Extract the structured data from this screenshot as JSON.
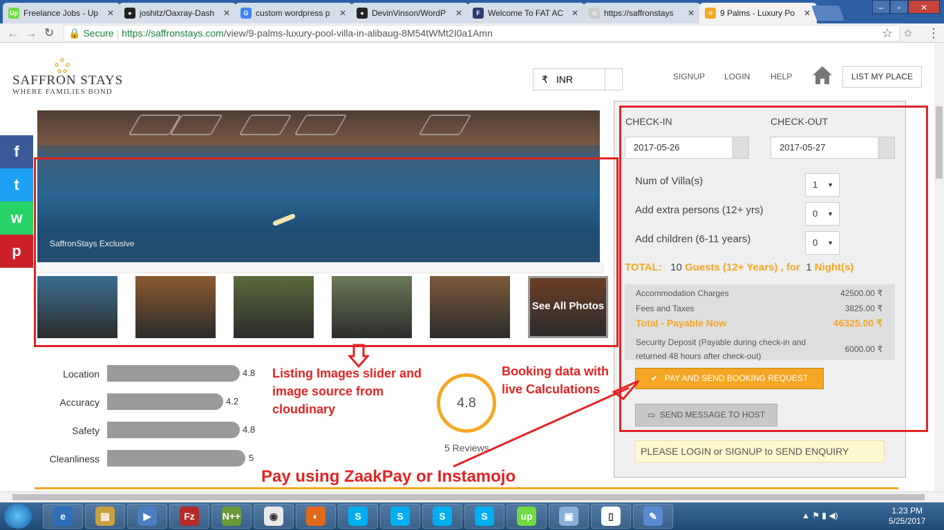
{
  "browser": {
    "tabs": [
      {
        "title": "Freelance Jobs - Up",
        "favicon": "upwork-icon",
        "color": "#6fda44",
        "fav_text": "Up"
      },
      {
        "title": "joshitz/Oaxray-Dash",
        "favicon": "github-icon",
        "color": "#222222",
        "fav_text": "●"
      },
      {
        "title": "custom wordpress p",
        "favicon": "google-icon",
        "color": "#4285f4",
        "fav_text": "G"
      },
      {
        "title": "DevinVinson/WordP",
        "favicon": "github-icon",
        "color": "#222222",
        "fav_text": "●"
      },
      {
        "title": "Welcome To FAT AC",
        "favicon": "site-icon",
        "color": "#2c3e70",
        "fav_text": "F"
      },
      {
        "title": "https://saffronstays",
        "favicon": "star-icon",
        "color": "#cccccc",
        "fav_text": "☆"
      },
      {
        "title": "9 Palms - Luxury Po",
        "favicon": "star-icon",
        "color": "#f5a623",
        "fav_text": "☆"
      }
    ],
    "secure_label": "Secure",
    "url_domain": "https://saffronstays.com",
    "url_path": "/view/9-palms-luxury-pool-villa-in-alibaug-8M54tWMt2I0a1Amn"
  },
  "header": {
    "brand": "SAFFRON STAYS",
    "tagline": "WHERE FAMILIES BOND",
    "currency_symbol": "₹",
    "currency": "INR",
    "nav": [
      "SIGNUP",
      "LOGIN",
      "HELP"
    ],
    "list_my_place": "LIST MY PLACE"
  },
  "social": [
    {
      "icon": "facebook-icon",
      "glyph": "f",
      "color": "#3b5998"
    },
    {
      "icon": "twitter-icon",
      "glyph": "t",
      "color": "#1da1f2"
    },
    {
      "icon": "whatsapp-icon",
      "glyph": "w",
      "color": "#25d366"
    },
    {
      "icon": "pinterest-icon",
      "glyph": "p",
      "color": "#cb2027"
    }
  ],
  "gallery": {
    "caption": "SaffronStays Exclusive",
    "see_all": "See All Photos",
    "thumb_colors": [
      "#3a6e8f",
      "#8a5a30",
      "#5a6a3a",
      "#6a7a55",
      "#7a5a3a",
      "#6b3e25"
    ]
  },
  "ratings": [
    {
      "label": "Location",
      "value": "4.8",
      "score": 4.8
    },
    {
      "label": "Accuracy",
      "value": "4.2",
      "score": 4.2
    },
    {
      "label": "Safety",
      "value": "4.8",
      "score": 4.8
    },
    {
      "label": "Cleanliness",
      "value": "5",
      "score": 5
    }
  ],
  "overall": {
    "score": "4.8",
    "reviews": "5 Reviews"
  },
  "booking": {
    "checkin_label": "CHECK-IN",
    "checkout_label": "CHECK-OUT",
    "checkin": "2017-05-26",
    "checkout": "2017-05-27",
    "villas_label": "Num of Villa(s)",
    "villas": "1",
    "extra_label": "Add extra persons (12+ yrs)",
    "extra": "0",
    "children_label": "Add children (6-11 years)",
    "children": "0",
    "total_label": "TOTAL:",
    "guests_count": "10",
    "guests_text": "Guests (12+ Years) , for",
    "nights_count": "1",
    "nights_text": "Night(s)",
    "charges": [
      {
        "label": "Accommodation Charges",
        "amount": "42500.00 ₹"
      },
      {
        "label": "Fees and Taxes",
        "amount": "3825.00 ₹"
      },
      {
        "label": "Total - Payable Now",
        "amount": "46325.00 ₹"
      },
      {
        "label": "Security Deposit (Payable during check-in and",
        "label2": "returned 48 hours after check-out)",
        "amount": "6000.00 ₹"
      }
    ],
    "pay_button": "PAY AND SEND BOOKING REQUEST",
    "message_button": "SEND MESSAGE TO HOST",
    "login_notice": "PLEASE LOGIN or SIGNUP to SEND ENQUIRY"
  },
  "annotations": {
    "slider_note": [
      "Listing Images slider and",
      "image source from",
      "cloudinary"
    ],
    "booking_note": [
      "Booking data with",
      "live Calculations"
    ],
    "pay_note": "Pay using ZaakPay or Instamojo",
    "color": "#e32222"
  },
  "taskbar": {
    "apps": [
      {
        "name": "ie-icon",
        "glyph": "e"
      },
      {
        "name": "explorer-icon",
        "glyph": "▤"
      },
      {
        "name": "media-player-icon",
        "glyph": "▶"
      },
      {
        "name": "filezilla-icon",
        "glyph": "Fz"
      },
      {
        "name": "notepadpp-icon",
        "glyph": "N++"
      },
      {
        "name": "chrome-icon",
        "glyph": "◉"
      },
      {
        "name": "firefox-icon",
        "glyph": "◐"
      },
      {
        "name": "skype-icon",
        "glyph": "S"
      },
      {
        "name": "skype-icon",
        "glyph": "S"
      },
      {
        "name": "skype-icon",
        "glyph": "S"
      },
      {
        "name": "skype-icon",
        "glyph": "S"
      },
      {
        "name": "upwork-icon",
        "glyph": "up"
      },
      {
        "name": "virtualbox-icon",
        "glyph": "▣"
      },
      {
        "name": "document-icon",
        "glyph": "▯"
      },
      {
        "name": "paint-icon",
        "glyph": "✎"
      }
    ],
    "time": "1:23 PM",
    "date": "5/25/2017"
  }
}
